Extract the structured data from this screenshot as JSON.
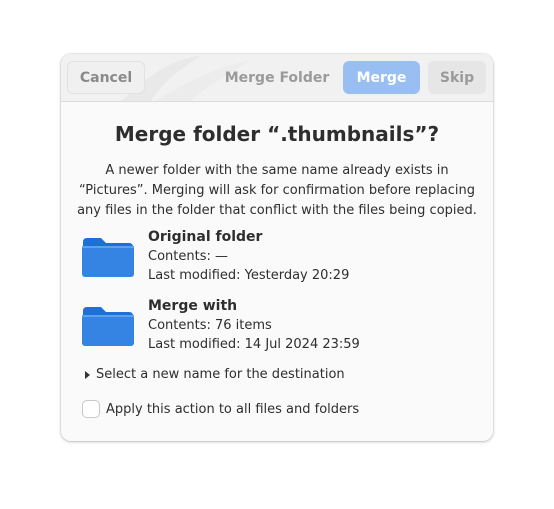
{
  "header": {
    "cancel_label": "Cancel",
    "title": "Merge Folder",
    "merge_label": "Merge",
    "skip_label": "Skip"
  },
  "dialog": {
    "heading": "Merge folder “.thumbnails”?",
    "body": "A newer folder with the same name already exists in “Pictures”. Merging will ask for confirmation before replacing any files in the folder that conflict with the files being copied."
  },
  "original": {
    "title": "Original folder",
    "contents": "Contents: —",
    "modified": "Last modified: Yesterday 20:29"
  },
  "merge_with": {
    "title": "Merge with",
    "contents": "Contents: 76 items",
    "modified": "Last modified: 14 Jul 2024 23:59"
  },
  "expander_label": "Select a new name for the destination",
  "checkbox_label": "Apply this action to all files and folders",
  "colors": {
    "accent": "#99bff2",
    "folder": "#3584e4",
    "folder_dark": "#1c71d8"
  },
  "icons": {
    "folder": "folder-icon",
    "expander": "pan-end-icon"
  }
}
